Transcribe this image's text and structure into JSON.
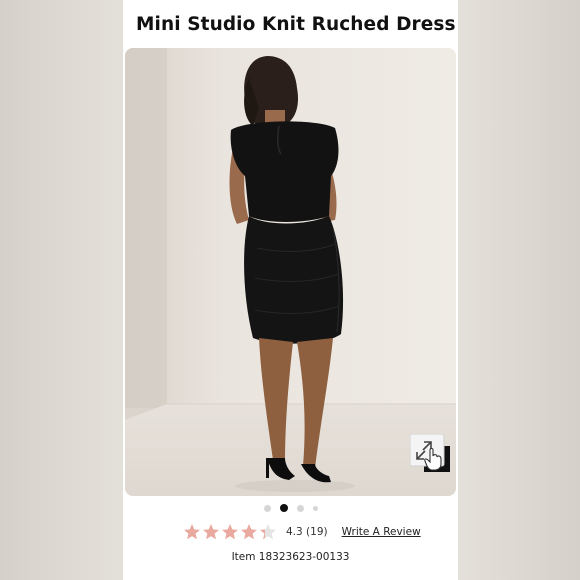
{
  "product": {
    "title": "Mini Studio Knit Ruched Dress",
    "image_alt": "Model wearing black ruched mini dress, back view",
    "gallery": {
      "total": 4,
      "active_index": 1
    }
  },
  "rating": {
    "value": "4.3",
    "score": 4.3,
    "max": 5,
    "count_text": "(19)",
    "write_review_label": "Write A Review",
    "star_color": "#e9a99f",
    "star_empty_color": "#e4e4e4"
  },
  "item": {
    "label": "Item 18323623-00133"
  },
  "icons": {
    "zoom": "expand-zoom-icon"
  }
}
